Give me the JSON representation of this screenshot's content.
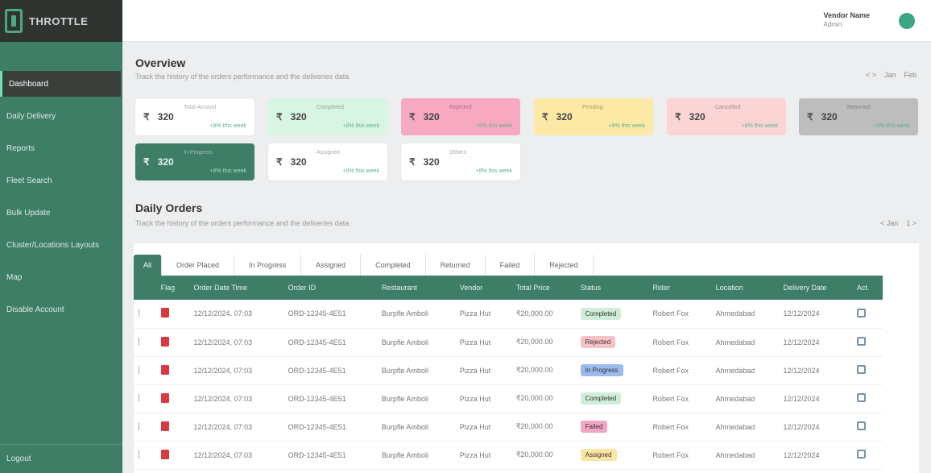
{
  "brand": {
    "name": "THROTTLE"
  },
  "sidebar": {
    "items": [
      {
        "label": "Dashboard",
        "active": true
      },
      {
        "label": "Daily Delivery",
        "active": false
      },
      {
        "label": "Reports",
        "active": false
      },
      {
        "label": "Fleet Search",
        "active": false
      },
      {
        "label": "Bulk Update",
        "active": false
      },
      {
        "label": "Cluster/Locations Layouts",
        "active": false
      },
      {
        "label": "Map",
        "active": false
      },
      {
        "label": "Disable Account",
        "active": false
      }
    ],
    "logout": "Logout"
  },
  "header": {
    "user_name": "Vendor Name",
    "user_role": "Admin"
  },
  "overview": {
    "title": "Overview",
    "subtitle": "Track the history of the orders performance and the deliveries data",
    "controls": [
      "< >",
      "Jan",
      "Feb"
    ],
    "cards": [
      {
        "icon": "₹",
        "value": "320",
        "label": "Total Amount",
        "change": "+8% this week",
        "bg": "#ffffff"
      },
      {
        "icon": "₹",
        "value": "320",
        "label": "Completed",
        "change": "+8% this week",
        "bg": "#d7f5e2"
      },
      {
        "icon": "₹",
        "value": "320",
        "label": "Rejected",
        "change": "+8% this week",
        "bg": "#f8a9c2"
      },
      {
        "icon": "₹",
        "value": "320",
        "label": "Pending",
        "change": "+8% this week",
        "bg": "#fce9a6"
      },
      {
        "icon": "₹",
        "value": "320",
        "label": "Cancelled",
        "change": "+8% this week",
        "bg": "#fbd4d4"
      },
      {
        "icon": "₹",
        "value": "320",
        "label": "Returned",
        "change": "+8% this week",
        "bg": "#bdbdbd"
      },
      {
        "icon": "₹",
        "value": "320",
        "label": "In Progress",
        "change": "+8% this week",
        "bg": "#3e7d66"
      },
      {
        "icon": "₹",
        "value": "320",
        "label": "Assigned",
        "change": "+8% this week",
        "bg": "#ffffff"
      },
      {
        "icon": "₹",
        "value": "320",
        "label": "Others",
        "change": "+8% this week",
        "bg": "#ffffff"
      }
    ]
  },
  "daily_orders": {
    "title": "Daily Orders",
    "subtitle": "Track the history of the orders performance and the deliveries data",
    "controls": [
      "< Jan",
      "1 >"
    ],
    "tabs": [
      "All",
      "Order Placed",
      "In Progress",
      "Assigned",
      "Completed",
      "Returned",
      "Failed",
      "Rejected"
    ],
    "columns": [
      "",
      "Flag",
      "Order Date Time",
      "Order ID",
      "Restaurant",
      "Vendor",
      "Total Price",
      "Status",
      "Rider",
      "Location",
      "Delivery Date",
      "Act."
    ],
    "rows": [
      {
        "date": "12/12/2024, 07:03",
        "order_id": "ORD-12345-4E51",
        "restaurant": "Burpfle Amboli",
        "vendor": "Pizza Hut",
        "price": "₹20,000.00",
        "status": "Completed",
        "status_color": "#cfeeda",
        "rider": "Robert Fox",
        "location": "Ahmedabad",
        "delivery": "12/12/2024"
      },
      {
        "date": "12/12/2024, 07:03",
        "order_id": "ORD-12345-4E51",
        "restaurant": "Burpfle Amboli",
        "vendor": "Pizza Hut",
        "price": "₹20,000.00",
        "status": "Rejected",
        "status_color": "#f6c2c6",
        "rider": "Robert Fox",
        "location": "Ahmedabad",
        "delivery": "12/12/2024"
      },
      {
        "date": "12/12/2024, 07:03",
        "order_id": "ORD-12345-4E51",
        "restaurant": "Burpfle Amboli",
        "vendor": "Pizza Hut",
        "price": "₹20,000.00",
        "status": "In Progress",
        "status_color": "#9db9ee",
        "rider": "Robert Fox",
        "location": "Ahmedabad",
        "delivery": "12/12/2024"
      },
      {
        "date": "12/12/2024, 07:03",
        "order_id": "ORD-12345-4E51",
        "restaurant": "Burpfle Amboli",
        "vendor": "Pizza Hut",
        "price": "₹20,000.00",
        "status": "Completed",
        "status_color": "#cfeeda",
        "rider": "Robert Fox",
        "location": "Ahmedabad",
        "delivery": "12/12/2024"
      },
      {
        "date": "12/12/2024, 07:03",
        "order_id": "ORD-12345-4E51",
        "restaurant": "Burpfle Amboli",
        "vendor": "Pizza Hut",
        "price": "₹20,000.00",
        "status": "Failed",
        "status_color": "#f3a6c4",
        "rider": "Robert Fox",
        "location": "Ahmedabad",
        "delivery": "12/12/2024"
      },
      {
        "date": "12/12/2024, 07:03",
        "order_id": "ORD-12345-4E51",
        "restaurant": "Burpfle Amboli",
        "vendor": "Pizza Hut",
        "price": "₹20,000.00",
        "status": "Assigned",
        "status_color": "#fbe7a3",
        "rider": "Robert Fox",
        "location": "Ahmedabad",
        "delivery": "12/12/2024"
      }
    ]
  }
}
